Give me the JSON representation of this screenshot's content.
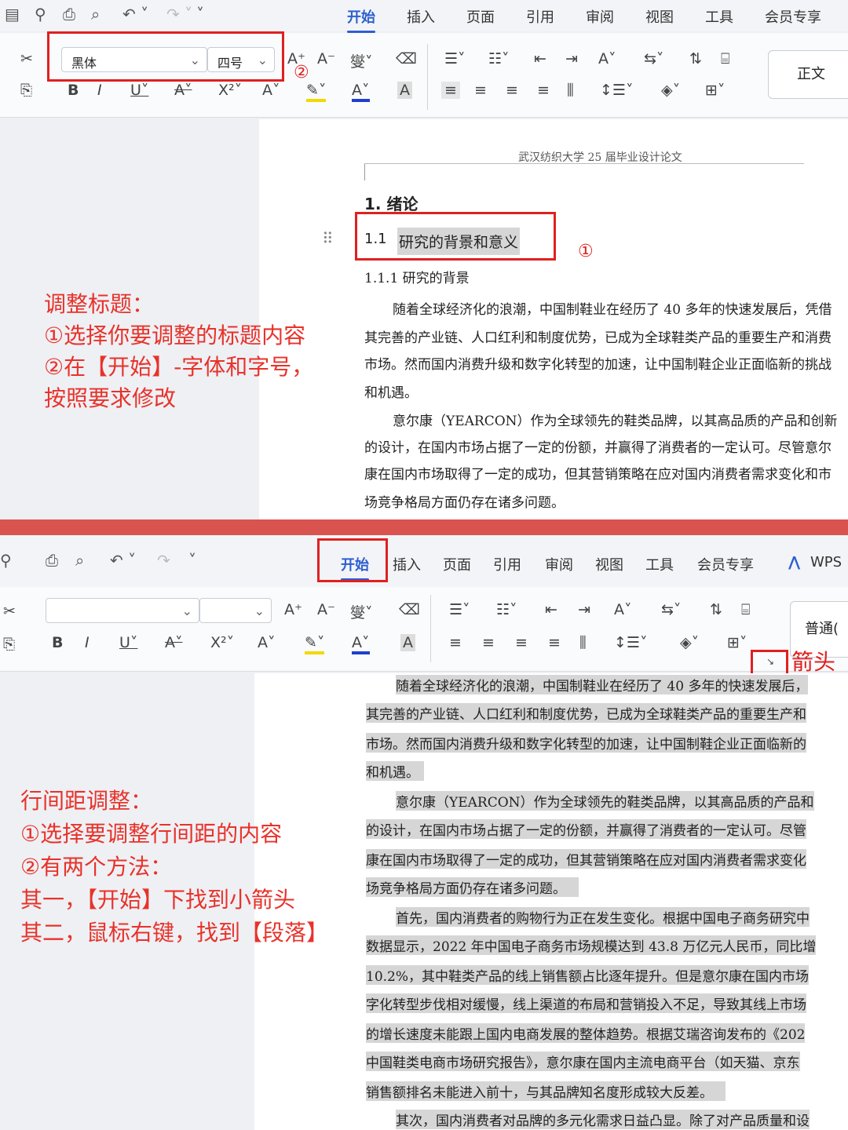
{
  "panel1": {
    "tabs": [
      "开始",
      "插入",
      "页面",
      "引用",
      "审阅",
      "视图",
      "工具",
      "会员专享"
    ],
    "font_name": "黑体",
    "font_size": "四号",
    "style_label": "正文",
    "annotation_1": "①",
    "annotation_2": "②",
    "doc": {
      "header": "武汉纺织大学 25 届毕业设计论文",
      "h1": "1.  绪论",
      "h2_num": "1.1",
      "h2_text": "研究的背景和意义",
      "h3": "1.1.1  研究的背景",
      "lines": [
        "随着全球经济化的浪潮，中国制鞋业在经历了 40 多年的快速发展后，凭借",
        "其完善的产业链、人口红利和制度优势，已成为全球鞋类产品的重要生产和消费",
        "市场。然而国内消费升级和数字化转型的加速，让中国制鞋企业正面临新的挑战",
        "和机遇。",
        "意尔康（YEARCON）作为全球领先的鞋类品牌，以其高品质的产品和创新",
        "的设计，在国内市场占据了一定的份额，并赢得了消费者的一定认可。尽管意尔",
        "康在国内市场取得了一定的成功，但其营销策略在应对国内消费者需求变化和市",
        "场竞争格局方面仍存在诸多问题。"
      ]
    },
    "note_lines": [
      "调整标题：",
      "①选择你要调整的标题内容",
      "②在【开始】-字体和字号，",
      "按照要求修改"
    ]
  },
  "panel2": {
    "tabs": [
      "开始",
      "插入",
      "页面",
      "引用",
      "审阅",
      "视图",
      "工具",
      "会员专享"
    ],
    "wps_label": "WPS",
    "style_label": "普通(",
    "arrow_label": "箭头",
    "doc_lines": [
      "随着全球经济化的浪潮，中国制鞋业在经历了 40 多年的快速发展后，",
      "其完善的产业链、人口红利和制度优势，已成为全球鞋类产品的重要生产和",
      "市场。然而国内消费升级和数字化转型的加速，让中国制鞋企业正面临新的",
      "和机遇。",
      "意尔康（YEARCON）作为全球领先的鞋类品牌，以其高品质的产品和",
      "的设计，在国内市场占据了一定的份额，并赢得了消费者的一定认可。尽管",
      "康在国内市场取得了一定的成功，但其营销策略在应对国内消费者需求变化",
      "场竞争格局方面仍存在诸多问题。",
      "首先，国内消费者的购物行为正在发生变化。根据中国电子商务研究中",
      "数据显示，2022 年中国电子商务市场规模达到 43.8 万亿元人民币，同比增",
      "10.2%，其中鞋类产品的线上销售额占比逐年提升。但是意尔康在国内市场",
      "字化转型步伐相对缓慢，线上渠道的布局和营销投入不足，导致其线上市场",
      "的增长速度未能跟上国内电商发展的整体趋势。根据艾瑞咨询发布的《202",
      "中国鞋类电商市场研究报告》，意尔康在国内主流电商平台（如天猫、京东",
      "销售额排名未能进入前十，与其品牌知名度形成较大反差。",
      "其次，国内消费者对品牌的多元化需求日益凸显。除了对产品质量和设"
    ],
    "note_lines": [
      "行间距调整：",
      "①选择要调整行间距的内容",
      "②有两个方法：",
      "其一，【开始】下找到小箭头",
      "其二，鼠标右键，找到【段落】"
    ]
  },
  "toolbar_icons": [
    "scissors-icon",
    "copy-icon",
    "bold-icon",
    "italic-icon",
    "underline-icon",
    "strikethrough-icon",
    "superscript-icon",
    "font-color-icon",
    "highlight-icon",
    "eraser-icon",
    "list-icon",
    "indent-icon",
    "align-icon",
    "border-icon"
  ],
  "colors": {
    "accent": "#2d5fd0",
    "annotation_red": "#e02020",
    "divider": "#d9534f"
  }
}
